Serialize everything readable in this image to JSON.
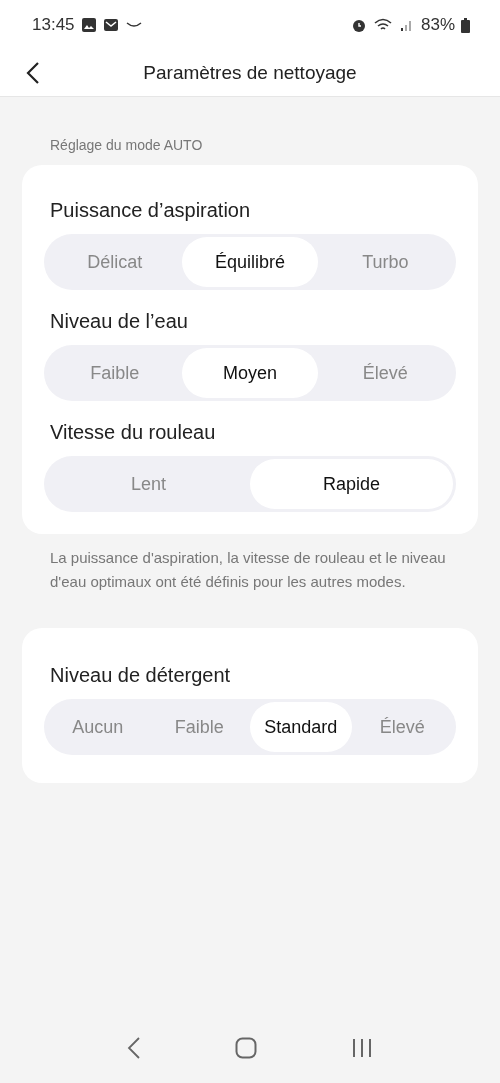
{
  "status_bar": {
    "time": "13:45",
    "battery": "83%"
  },
  "header": {
    "title": "Paramètres de nettoyage"
  },
  "auto_section": {
    "label": "Réglage du mode AUTO",
    "groups": [
      {
        "title": "Puissance d’aspiration",
        "options": [
          {
            "label": "Délicat",
            "selected": false
          },
          {
            "label": "Équilibré",
            "selected": true
          },
          {
            "label": "Turbo",
            "selected": false
          }
        ]
      },
      {
        "title": "Niveau de l’eau",
        "options": [
          {
            "label": "Faible",
            "selected": false
          },
          {
            "label": "Moyen",
            "selected": true
          },
          {
            "label": "Élevé",
            "selected": false
          }
        ]
      },
      {
        "title": "Vitesse du rouleau",
        "options": [
          {
            "label": "Lent",
            "selected": false
          },
          {
            "label": "Rapide",
            "selected": true
          }
        ]
      }
    ]
  },
  "note": "La puissance d'aspiration, la vitesse de rouleau et le niveau d'eau optimaux ont été définis pour les autres modes.",
  "detergent": {
    "title": "Niveau de détergent",
    "options": [
      {
        "label": "Aucun",
        "selected": false
      },
      {
        "label": "Faible",
        "selected": false
      },
      {
        "label": "Standard",
        "selected": true
      },
      {
        "label": "Élevé",
        "selected": false
      }
    ]
  }
}
